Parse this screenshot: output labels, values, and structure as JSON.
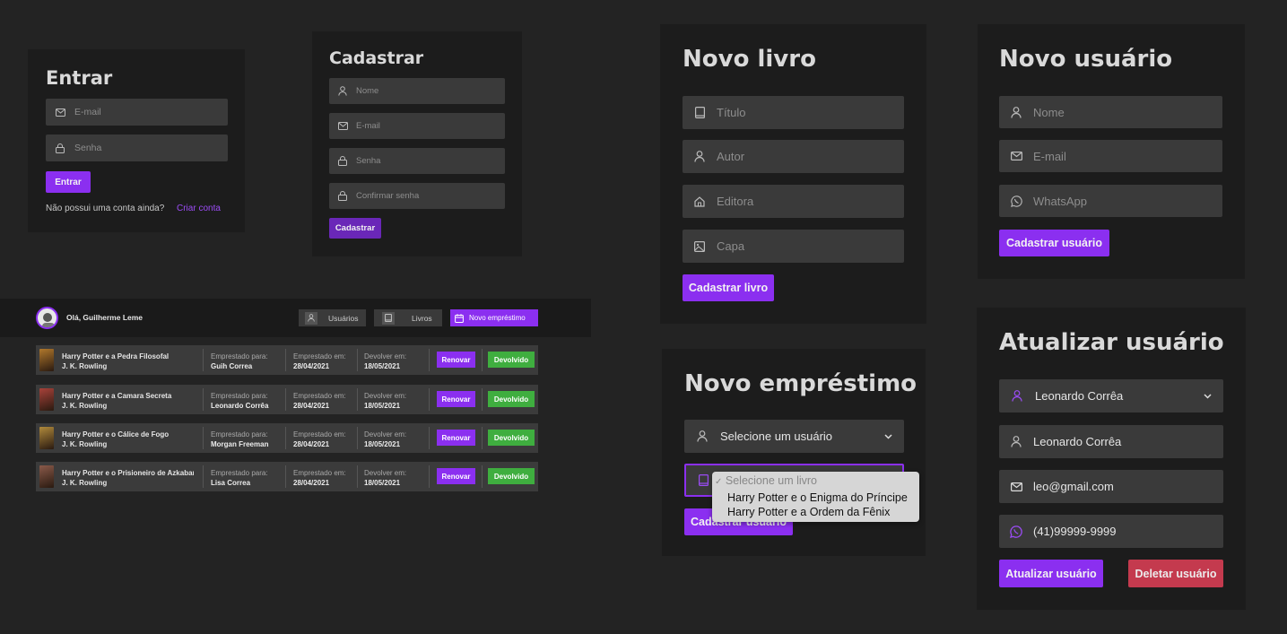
{
  "login": {
    "title": "Entrar",
    "email_placeholder": "E-mail",
    "password_placeholder": "Senha",
    "submit": "Entrar",
    "no_account": "Não possui uma conta ainda?",
    "create_link": "Criar conta"
  },
  "register": {
    "title": "Cadastrar",
    "name_placeholder": "Nome",
    "email_placeholder": "E-mail",
    "password_placeholder": "Senha",
    "confirm_placeholder": "Confirmar senha",
    "submit": "Cadastrar"
  },
  "new_book": {
    "title": "Novo livro",
    "title_placeholder": "Título",
    "author_placeholder": "Autor",
    "publisher_placeholder": "Editora",
    "cover_placeholder": "Capa",
    "submit": "Cadastrar livro"
  },
  "new_user": {
    "title": "Novo usuário",
    "name_placeholder": "Nome",
    "email_placeholder": "E-mail",
    "whatsapp_placeholder": "WhatsApp",
    "submit": "Cadastrar usuário"
  },
  "new_loan": {
    "title": "Novo empréstimo",
    "user_select": "Selecione um usuário",
    "submit": "Cadastrar usuário",
    "book_options": [
      "Selecione um livro",
      "Harry Potter e o Enigma do Príncipe",
      "Harry Potter e a Ordem da Fênix"
    ]
  },
  "update_user": {
    "title": "Atualizar usuário",
    "selected_user": "Leonardo Corrêa",
    "name": "Leonardo Corrêa",
    "email": "leo@gmail.com",
    "phone": "(41)99999-9999",
    "update": "Atualizar usuário",
    "delete": "Deletar usuário"
  },
  "dashboard": {
    "greeting": "Olá, Guilherme Leme",
    "nav": {
      "users": "Usuários",
      "books": "Livros",
      "new_loan": "Novo empréstimo"
    },
    "labels": {
      "lent_to": "Emprestado para:",
      "lent_on": "Emprestado em:",
      "return_on": "Devolver em:",
      "renew": "Renovar",
      "returned": "Devolvido"
    },
    "loans": [
      {
        "book": "Harry Potter e a Pedra Filosofal",
        "author": "J. K. Rowling",
        "borrower": "Guih Correa",
        "lent_on": "28/04/2021",
        "return_on": "18/05/2021",
        "cover_color": "#b0782c"
      },
      {
        "book": "Harry Potter e a Camara Secreta",
        "author": "J. K. Rowling",
        "borrower": "Leonardo Corrêa",
        "lent_on": "28/04/2021",
        "return_on": "18/05/2021",
        "cover_color": "#a8423a"
      },
      {
        "book": "Harry Potter e o Cálice de Fogo",
        "author": "J. K. Rowling",
        "borrower": "Morgan Freeman",
        "lent_on": "28/04/2021",
        "return_on": "18/05/2021",
        "cover_color": "#b08a3c"
      },
      {
        "book": "Harry Potter e o Prisioneiro de Azkaban",
        "author": "J. K. Rowling",
        "borrower": "Lisa Correa",
        "lent_on": "28/04/2021",
        "return_on": "18/05/2021",
        "cover_color": "#8a5a4a"
      }
    ]
  },
  "colors": {
    "accent": "#8b2ff0",
    "success": "#3fae3f",
    "danger": "#c43a4e",
    "field": "#3a3a3a",
    "panel": "#1c1c1c"
  }
}
